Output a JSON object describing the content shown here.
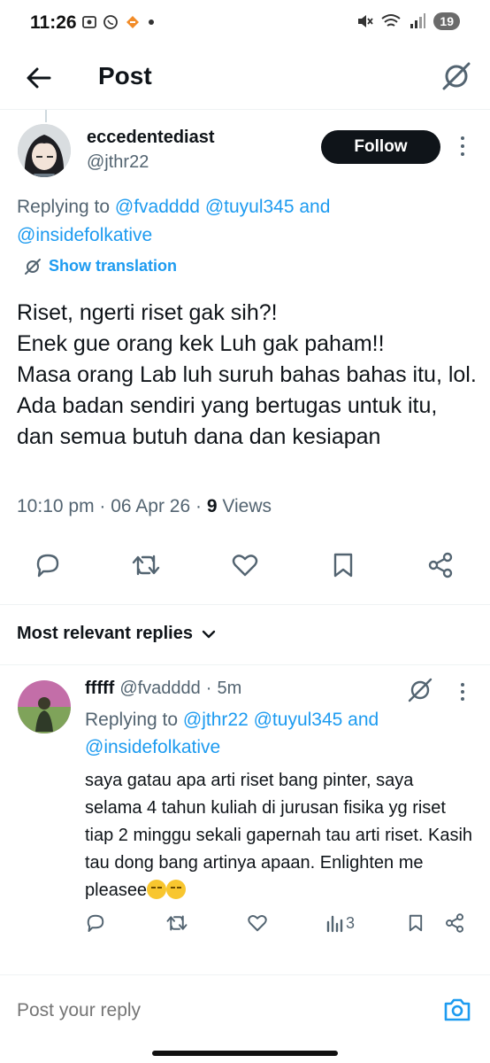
{
  "status_bar": {
    "time": "11:26",
    "battery": "19"
  },
  "header": {
    "title": "Post"
  },
  "post": {
    "author_name": "eccedentediast",
    "author_handle": "@jthr22",
    "follow_label": "Follow",
    "replying_prefix": "Replying to",
    "replying_mentions": [
      "@fvadddd",
      "@tuyul345",
      "@insidefolkative"
    ],
    "replying_and": "and",
    "show_translation": "Show translation",
    "text_lines": [
      "Riset, ngerti riset gak sih?!",
      "Enek gue orang kek Luh gak paham!!",
      "Masa orang Lab luh suruh bahas bahas itu, lol. Ada badan sendiri yang bertugas untuk itu, dan semua butuh dana dan kesiapan"
    ],
    "time": "10:10 pm",
    "date": "06 Apr 26",
    "views_count": "9",
    "views_label": "Views"
  },
  "replies_section": {
    "sort_label": "Most relevant replies"
  },
  "reply": {
    "name": "fffff",
    "handle": "@fvadddd",
    "age": "5m",
    "replying_prefix": "Replying to",
    "replying_mentions": [
      "@jthr22",
      "@tuyul345",
      "@insidefolkative"
    ],
    "replying_and": "and",
    "text": "saya gatau apa arti riset bang pinter, saya selama 4 tahun kuliah di jurusan fisika yg riset tiap 2 minggu sekali gapernah tau arti riset. Kasih tau dong bang artinya apaan. Enlighten me pleasee",
    "views_count": "3"
  },
  "composer": {
    "placeholder": "Post your reply"
  },
  "colors": {
    "accent": "#1d9bf0",
    "text": "#0f1419",
    "muted": "#536471"
  }
}
